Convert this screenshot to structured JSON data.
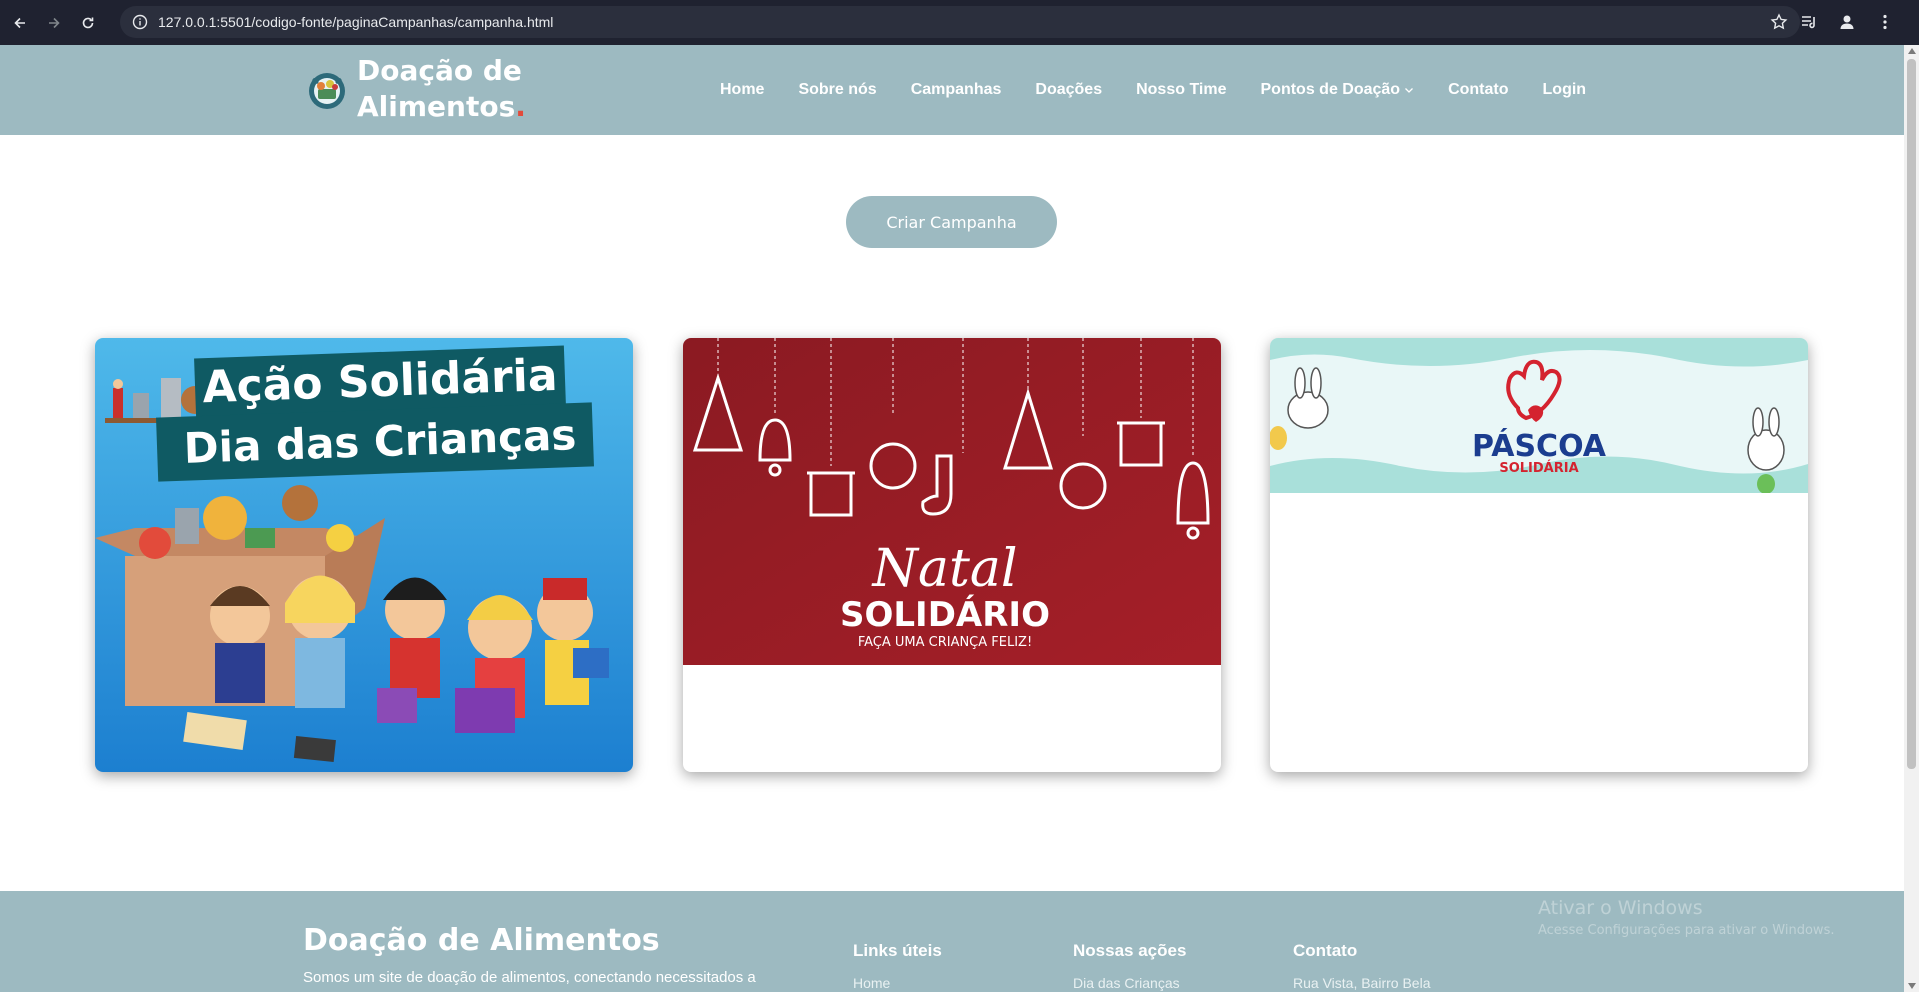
{
  "browser": {
    "url": "127.0.0.1:5501/codigo-fonte/paginaCampanhas/campanha.html"
  },
  "header": {
    "logo_line1": "Doação de",
    "logo_line2": "Alimentos",
    "logo_dot": ".",
    "nav": [
      {
        "label": "Home"
      },
      {
        "label": "Sobre nós"
      },
      {
        "label": "Campanhas"
      },
      {
        "label": "Doações"
      },
      {
        "label": "Nosso Time"
      },
      {
        "label": "Pontos de Doação"
      },
      {
        "label": "Contato"
      },
      {
        "label": "Login"
      }
    ]
  },
  "main": {
    "create_button": "Criar Campanha",
    "cards": [
      {
        "line1": "Ação Solidária",
        "line2": "Dia das Crianças"
      },
      {
        "script": "Natal",
        "title": "SOLIDÁRIO",
        "subtitle": "FAÇA UMA CRIANÇA FELIZ!"
      },
      {
        "title": "PÁSCOA",
        "subtitle": "SOLIDÁRIA"
      }
    ]
  },
  "footer": {
    "title": "Doação de Alimentos",
    "description": "Somos um site de doação de alimentos, conectando necessitados a",
    "col1_title": "Links úteis",
    "col1_first": "Home",
    "col2_title": "Nossas ações",
    "col2_first": "Dia das Crianças",
    "col3_title": "Contato",
    "col3_first": "Rua Vista, Bairro Bela",
    "watermark_title": "Ativar o Windows",
    "watermark_text": "Acesse Configurações para ativar o Windows."
  },
  "colors": {
    "header_bg": "#9dbac1",
    "logo_accent": "#e24b3b",
    "natal_red": "#9b1c24",
    "pascoa_blue": "#1b3d8f",
    "pascoa_red": "#d4232f",
    "crianca_sky": "#48b3e6",
    "crianca_banner": "#0f5a63"
  }
}
